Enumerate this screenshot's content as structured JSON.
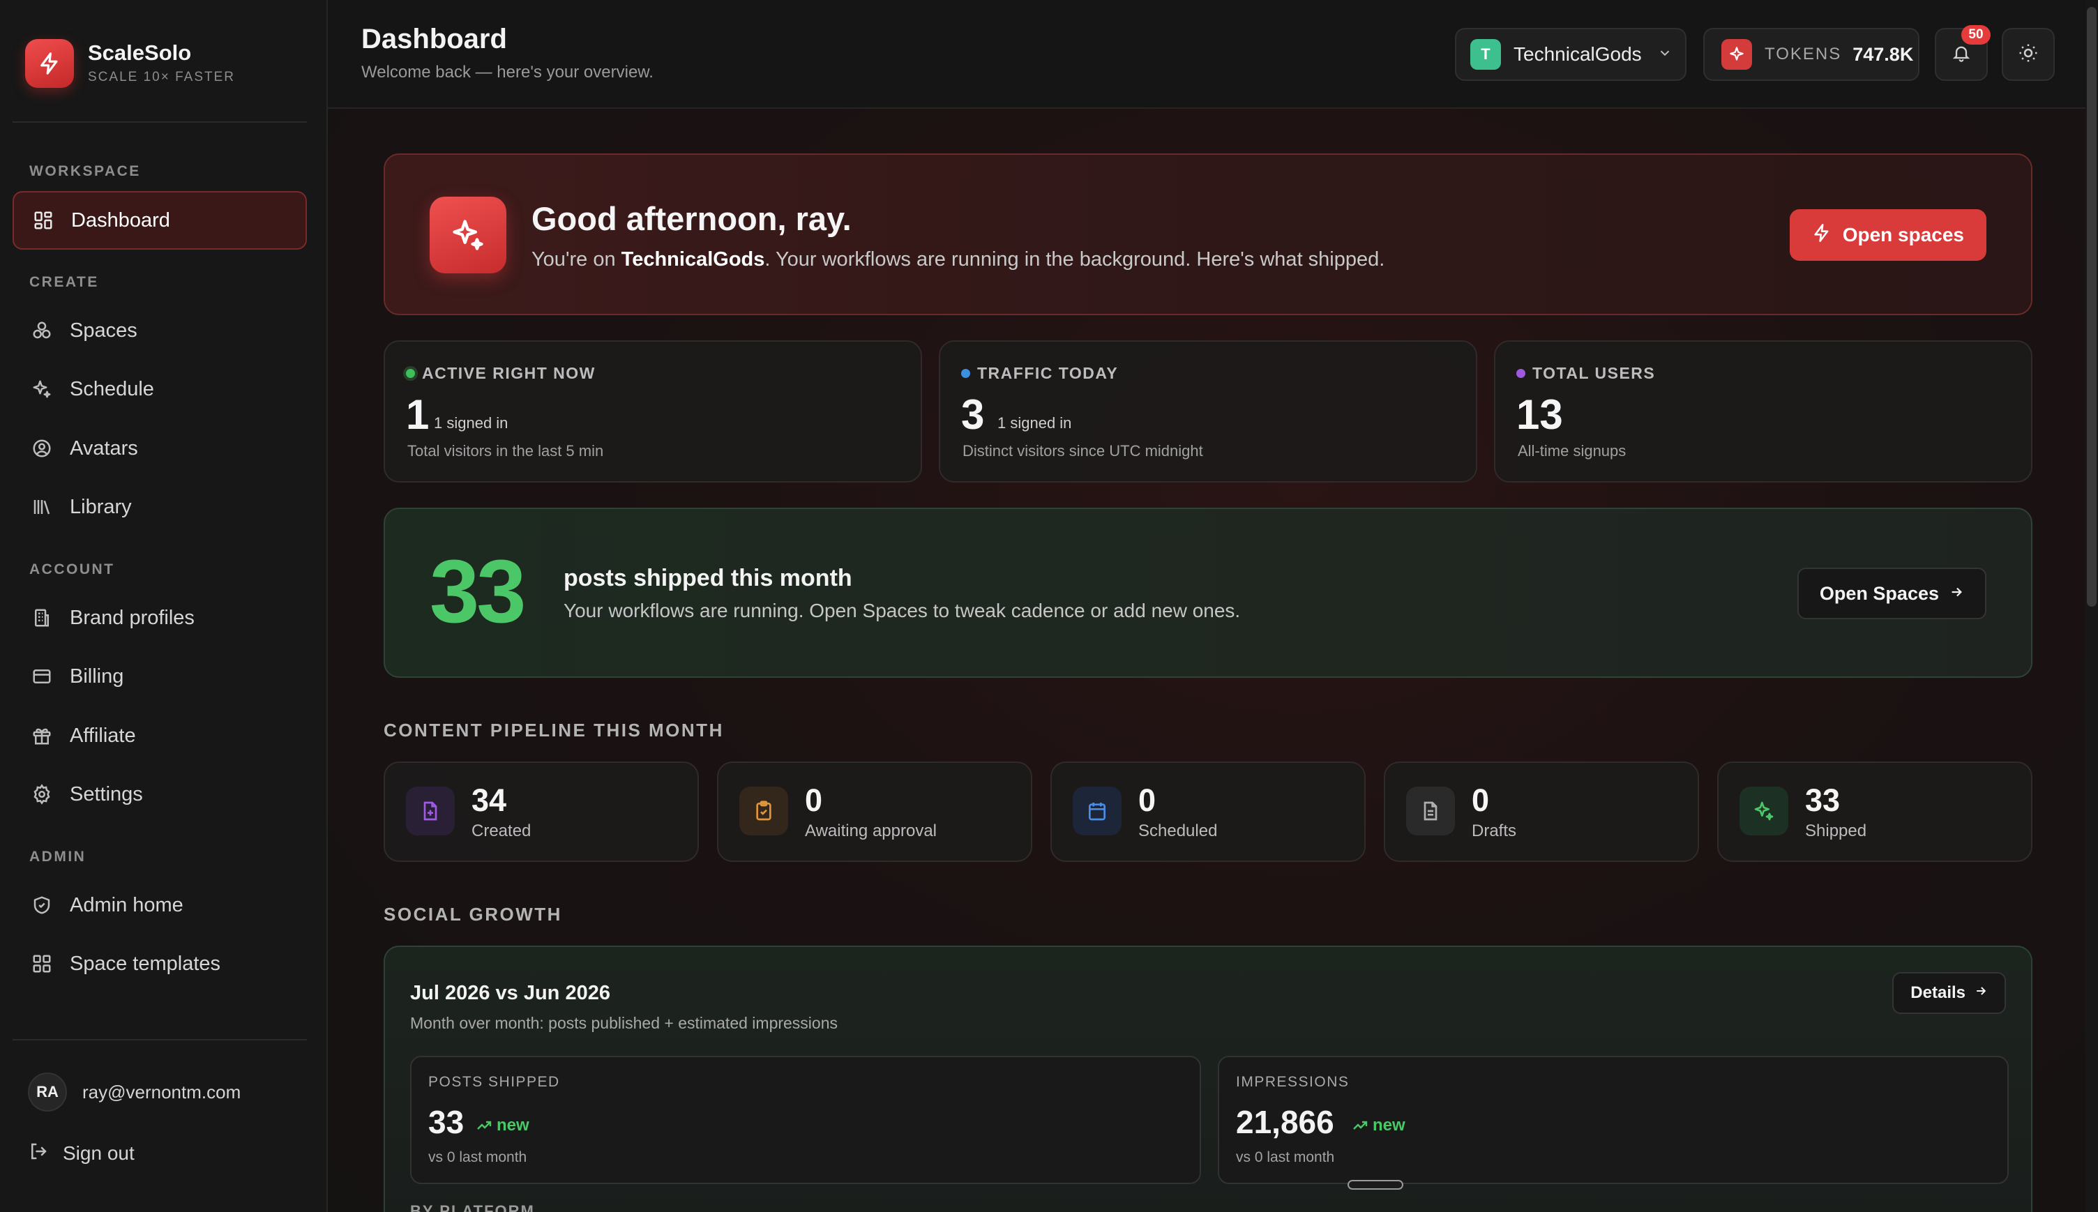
{
  "brand": {
    "name": "ScaleSolo",
    "tagline": "SCALE 10× FASTER",
    "accent": "#d93a3a"
  },
  "sidebar": {
    "sections": {
      "workspace": "WORKSPACE",
      "create": "CREATE",
      "account": "ACCOUNT",
      "admin": "ADMIN"
    },
    "items": [
      {
        "label": "Dashboard",
        "icon": "dashboard-grid-icon",
        "active": true
      },
      {
        "label": "Spaces",
        "icon": "spaces-icon"
      },
      {
        "label": "Schedule",
        "icon": "sparkles-icon"
      },
      {
        "label": "Avatars",
        "icon": "user-circle-icon"
      },
      {
        "label": "Library",
        "icon": "library-icon"
      },
      {
        "label": "Brand profiles",
        "icon": "building-icon"
      },
      {
        "label": "Billing",
        "icon": "credit-card-icon"
      },
      {
        "label": "Affiliate",
        "icon": "gift-icon"
      },
      {
        "label": "Settings",
        "icon": "gear-icon"
      },
      {
        "label": "Admin home",
        "icon": "shield-icon"
      },
      {
        "label": "Space templates",
        "icon": "grid-icon"
      }
    ],
    "user": {
      "initials": "RA",
      "email": "ray@vernontm.com"
    },
    "signout": "Sign out"
  },
  "header": {
    "title": "Dashboard",
    "subtitle": "Welcome back — here's your overview.",
    "workspace": {
      "initial": "T",
      "name": "TechnicalGods"
    },
    "tokens": {
      "label": "TOKENS",
      "value": "747.8K"
    },
    "notifications": {
      "count": "50"
    }
  },
  "hero": {
    "title": "Good afternoon, ray.",
    "text_prefix": "You're on ",
    "workspace": "TechnicalGods",
    "text_suffix": ". Your workflows are running in the background. Here's what shipped.",
    "button": "Open spaces"
  },
  "stats": [
    {
      "label": "ACTIVE RIGHT NOW",
      "value": "1",
      "sub": "1 signed in",
      "foot": "Total visitors in the last 5 min",
      "color": "#3fbf5a"
    },
    {
      "label": "TRAFFIC TODAY",
      "value": "3",
      "sub": "1 signed in",
      "foot": "Distinct visitors since UTC midnight",
      "color": "#3d8fe0"
    },
    {
      "label": "TOTAL USERS",
      "value": "13",
      "sub": "",
      "foot": "All-time signups",
      "color": "#a05ae0"
    }
  ],
  "shipped": {
    "count": "33",
    "title": "posts shipped this month",
    "text": "Your workflows are running. Open Spaces to tweak cadence or add new ones.",
    "button": "Open Spaces"
  },
  "pipeline": {
    "title": "CONTENT PIPELINE THIS MONTH",
    "items": [
      {
        "value": "34",
        "label": "Created",
        "icon": "file-plus-icon",
        "color": "#a15ae6",
        "bg": "#2a2035"
      },
      {
        "value": "0",
        "label": "Awaiting approval",
        "icon": "clipboard-check-icon",
        "color": "#e0953a",
        "bg": "#33261a"
      },
      {
        "value": "0",
        "label": "Scheduled",
        "icon": "calendar-icon",
        "color": "#4a8ce8",
        "bg": "#1d2538"
      },
      {
        "value": "0",
        "label": "Drafts",
        "icon": "document-icon",
        "color": "#a9a9a9",
        "bg": "#2a2a2a"
      },
      {
        "value": "33",
        "label": "Shipped",
        "icon": "sparkles-icon",
        "color": "#4cc768",
        "bg": "#1d3024"
      }
    ]
  },
  "growth": {
    "section": "SOCIAL GROWTH",
    "title": "Jul 2026 vs Jun 2026",
    "subtitle": "Month over month: posts published + estimated impressions",
    "button": "Details",
    "metrics": [
      {
        "label": "POSTS SHIPPED",
        "value": "33",
        "trend": "new",
        "foot": "vs 0 last month"
      },
      {
        "label": "IMPRESSIONS",
        "value": "21,866",
        "trend": "new",
        "foot": "vs 0 last month"
      }
    ],
    "platform_label": "BY PLATFORM"
  }
}
